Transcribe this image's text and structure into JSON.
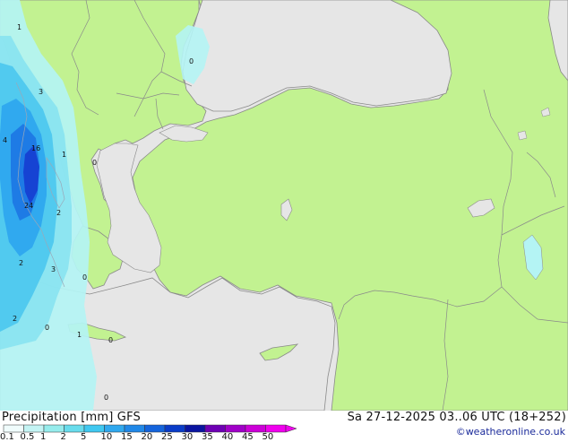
{
  "map": {
    "colors": {
      "sea": "#e6e6e6",
      "land": "#c2f291",
      "coast": "#8a8a8a",
      "border": "#8a8a8a",
      "precip_1": "#b4f4f4",
      "precip_2": "#8ae4f0",
      "precip_3": "#4ec8ee",
      "precip_4": "#2ea6ee",
      "precip_5": "#1e78e4",
      "precip_6": "#1640d2"
    },
    "point_labels": [
      {
        "id": "p-1a",
        "text": "1"
      },
      {
        "id": "p-3a",
        "text": "3"
      },
      {
        "id": "p-0a",
        "text": "0"
      },
      {
        "id": "p-4",
        "text": "4"
      },
      {
        "id": "p-16",
        "text": "16"
      },
      {
        "id": "p-1b",
        "text": "1"
      },
      {
        "id": "p-0b",
        "text": "0"
      },
      {
        "id": "p-24",
        "text": "24"
      },
      {
        "id": "p-2a",
        "text": "2"
      },
      {
        "id": "p-2b",
        "text": "2"
      },
      {
        "id": "p-3b",
        "text": "3"
      },
      {
        "id": "p-0c",
        "text": "0"
      },
      {
        "id": "p-2c",
        "text": "2"
      },
      {
        "id": "p-0d",
        "text": "0"
      },
      {
        "id": "p-1c",
        "text": "1"
      },
      {
        "id": "p-0e",
        "text": "0"
      },
      {
        "id": "p-0f",
        "text": "0"
      }
    ]
  },
  "footer": {
    "title": "Precipitation [mm]  GFS",
    "datetime": "Sa 27-12-2025 03..06 UTC (18+252)",
    "credit": "©weatheronline.co.uk"
  },
  "legend": {
    "ticks": [
      "0.1",
      "0.5",
      "1",
      "2",
      "5",
      "10",
      "15",
      "20",
      "25",
      "30",
      "35",
      "40",
      "45",
      "50"
    ],
    "colors": [
      "#f0fcfc",
      "#c4f4f4",
      "#96ecec",
      "#68dcec",
      "#40c8f0",
      "#30a8ee",
      "#2088e8",
      "#1464dc",
      "#0a3cc8",
      "#0a14a0",
      "#6e00b4",
      "#a000c8",
      "#cc00d8",
      "#f000ee"
    ]
  }
}
